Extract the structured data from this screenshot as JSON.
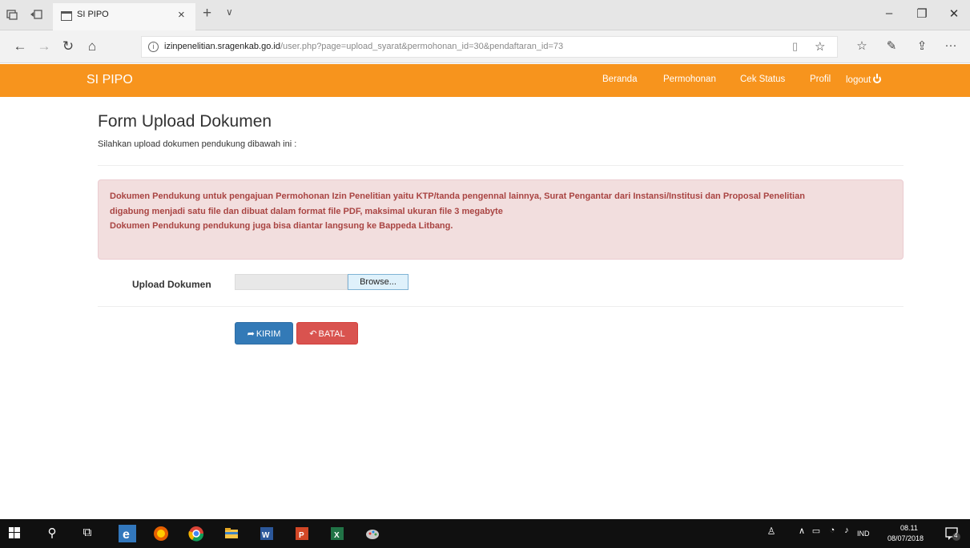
{
  "browser": {
    "tab_title": "SI PIPO",
    "tab_close": "×",
    "new_tab": "+",
    "tab_menu": "∨",
    "win_minimize": "–",
    "win_restore": "❐",
    "win_close": "✕",
    "url_domain": "izinpenelitian.sragenkab.go.id",
    "url_path": "/user.php?page=upload_syarat&permohonan_id=30&pendaftaran_id=73",
    "more": "···"
  },
  "navbar": {
    "brand": "SI PIPO",
    "links": [
      "Beranda",
      "Permohonan",
      "Cek Status",
      "Profil",
      "logout"
    ],
    "color": "#f7941d"
  },
  "page": {
    "title": "Form Upload Dokumen",
    "subtitle": "Silahkan upload dokumen pendukung dibawah ini :",
    "alert_lines": [
      "Dokumen Pendukung untuk pengajuan Permohonan Izin Penelitian yaitu KTP/tanda pengennal lainnya, Surat Pengantar dari Instansi/Institusi dan Proposal Penelitian",
      "digabung menjadi satu file dan dibuat dalam format file PDF, maksimal ukuran file 3 megabyte",
      "Dokumen Pendukung pendukung juga bisa diantar langsung ke Bappeda Litbang."
    ],
    "upload_label": "Upload Dokumen",
    "browse_label": "Browse...",
    "kirim_label": "KIRIM",
    "batal_label": "BATAL"
  },
  "taskbar": {
    "lang": "IND",
    "time": "08.11",
    "date": "08/07/2018",
    "notif_count": "4"
  }
}
